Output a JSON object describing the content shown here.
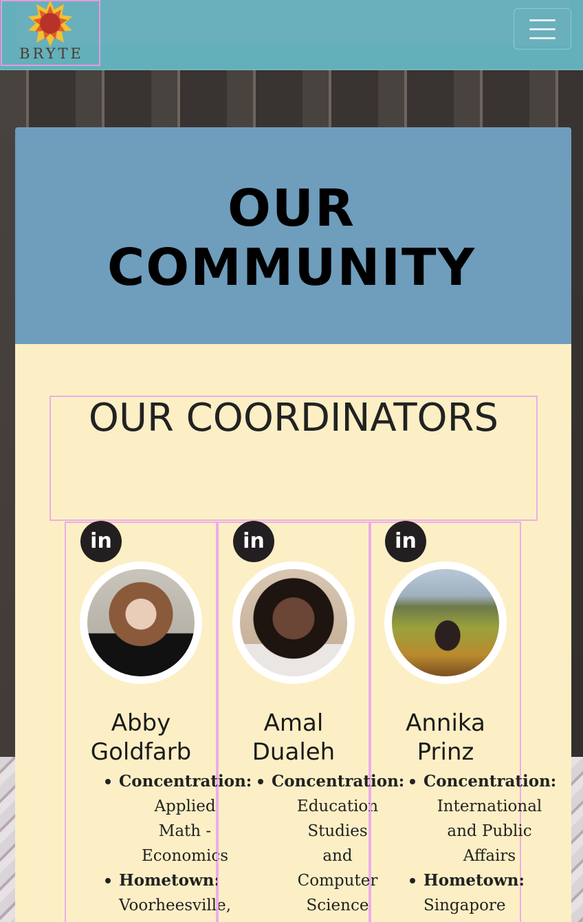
{
  "navbar": {
    "brand": "BRYTE",
    "menu_icon": "hamburger-menu-icon"
  },
  "hero": {
    "title_line1": "OUR",
    "title_line2": "COMMUNITY"
  },
  "section": {
    "heading": "OUR COORDINATORS"
  },
  "coordinators": [
    {
      "linkedin": "in",
      "name_first": "Abby",
      "name_last": "Goldfarb",
      "concentration_label": "Concentration:",
      "concentration": [
        "Applied",
        "Math -",
        "Economics"
      ],
      "hometown_label": "Hometown:",
      "hometown": "Voorheesville,"
    },
    {
      "linkedin": "in",
      "name_first": "Amal",
      "name_last": "Dualeh",
      "concentration_label": "Concentration:",
      "concentration": [
        "Education",
        "Studies",
        "and",
        "Computer",
        "Science"
      ],
      "hometown_label": "",
      "hometown": ""
    },
    {
      "linkedin": "in",
      "name_first": "Annika",
      "name_last": "Prinz",
      "concentration_label": "Concentration:",
      "concentration": [
        "International",
        "and Public",
        "Affairs"
      ],
      "hometown_label": "Hometown:",
      "hometown": "Singapore"
    }
  ],
  "colors": {
    "navbar": "#63b0bb",
    "hero": "#6f9dbc",
    "content": "#fcefc5",
    "badge": "#231f20"
  }
}
